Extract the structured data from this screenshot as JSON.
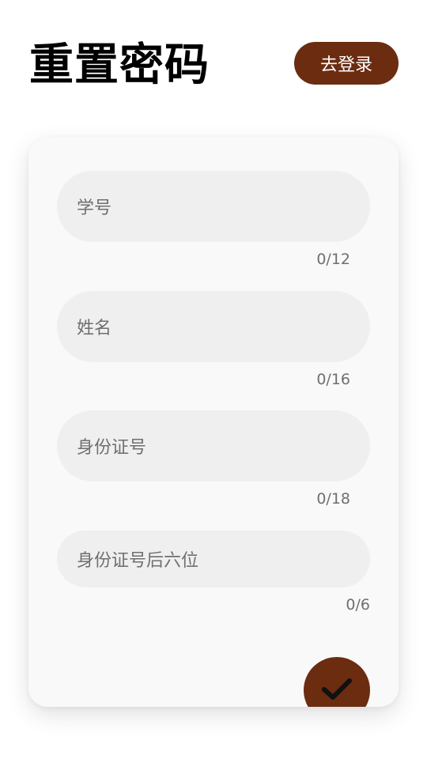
{
  "header": {
    "title": "重置密码",
    "login_label": "去登录"
  },
  "form": {
    "fields": [
      {
        "placeholder": "学号",
        "counter": "0/12"
      },
      {
        "placeholder": "姓名",
        "counter": "0/16"
      },
      {
        "placeholder": "身份证号",
        "counter": "0/18"
      },
      {
        "placeholder": "身份证号后六位",
        "counter": "0/6"
      }
    ],
    "submit_icon": "check-icon"
  },
  "colors": {
    "accent": "#6b2c10",
    "card_bg": "#f9f9f9",
    "field_bg": "#efefef",
    "hint_text": "#6f6f6f"
  }
}
